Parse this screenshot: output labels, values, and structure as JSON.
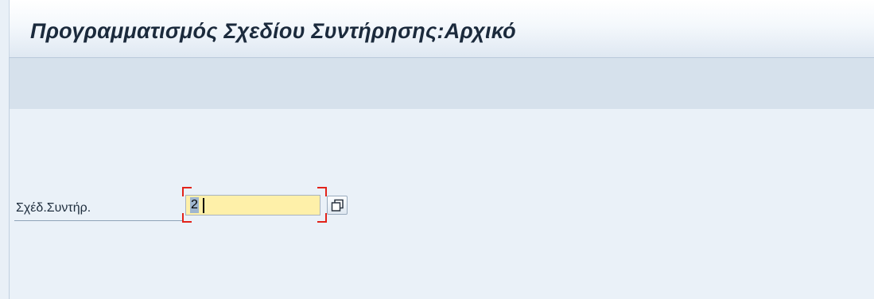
{
  "title_bar": {
    "title": "Προγραμματισμός Σχεδίου Συντήρησης:Αρχικό"
  },
  "form": {
    "field_label": "Σχέδ.Συντήρ.",
    "field_value": "2",
    "value_help_icon": "copy-icon"
  },
  "colors": {
    "input_background": "#fef0a9",
    "required_marker": "#e2231a",
    "toolbar_background": "#d6e1ec"
  }
}
